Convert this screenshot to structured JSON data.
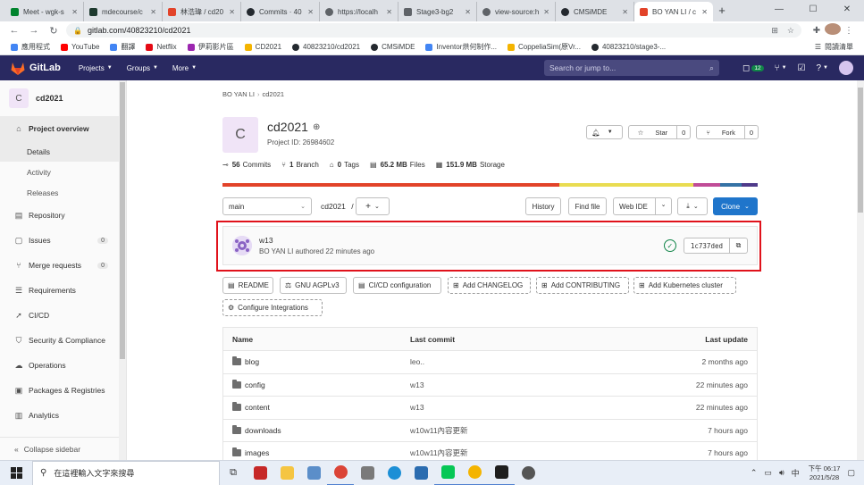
{
  "browser": {
    "tabs": [
      {
        "title": "Meet - wgk-s",
        "color": "#00832d"
      },
      {
        "title": "mdecourse/c",
        "color": "#1e3a2f"
      },
      {
        "title": "林浩瑋 / cd20",
        "color": "#e24329"
      },
      {
        "title": "Commits · 40",
        "color": "#24292f"
      },
      {
        "title": "https://localh",
        "color": "#5f6368"
      },
      {
        "title": "Stage3-bg2",
        "color": "#5f6368"
      },
      {
        "title": "view-source:h",
        "color": "#5f6368"
      },
      {
        "title": "CMSiMDE",
        "color": "#24292f"
      },
      {
        "title": "BO YAN LI / c",
        "color": "#e24329"
      }
    ],
    "new_tab": "+",
    "url": "gitlab.com/40823210/cd2021",
    "bookmarks": [
      {
        "label": "應用程式",
        "color": "#4285f4"
      },
      {
        "label": "YouTube",
        "color": "#ff0000"
      },
      {
        "label": "翻譯",
        "color": "#4285f4"
      },
      {
        "label": "Netflix",
        "color": "#e50914"
      },
      {
        "label": "伊莉影片區",
        "color": "#9c27b0"
      },
      {
        "label": "CD2021",
        "color": "#f4b400"
      },
      {
        "label": "40823210/cd2021",
        "color": "#24292f"
      },
      {
        "label": "CMSiMDE",
        "color": "#24292f"
      },
      {
        "label": "Inventor烘何制作...",
        "color": "#4285f4"
      },
      {
        "label": "CoppeliaSim(原Vr...",
        "color": "#f4b400"
      },
      {
        "label": "40823210/stage3-...",
        "color": "#24292f"
      }
    ],
    "reading_list": "閱讀清單"
  },
  "gitlab": {
    "brand": "GitLab",
    "menus": [
      "Projects",
      "Groups",
      "More"
    ],
    "search_placeholder": "Search or jump to...",
    "mr_count": "12",
    "accent": "#292961"
  },
  "sidebar": {
    "project_initial": "C",
    "project_name": "cd2021",
    "items": [
      {
        "label": "Project overview",
        "icon": "home-icon"
      },
      {
        "label": "Details"
      },
      {
        "label": "Activity"
      },
      {
        "label": "Releases"
      },
      {
        "label": "Repository",
        "icon": "doc-icon"
      },
      {
        "label": "Issues",
        "icon": "issues-icon",
        "count": "0"
      },
      {
        "label": "Merge requests",
        "icon": "merge-icon",
        "count": "0"
      },
      {
        "label": "Requirements",
        "icon": "list-icon"
      },
      {
        "label": "CI/CD",
        "icon": "rocket-icon"
      },
      {
        "label": "Security & Compliance",
        "icon": "shield-icon"
      },
      {
        "label": "Operations",
        "icon": "cloud-icon"
      },
      {
        "label": "Packages & Registries",
        "icon": "package-icon"
      },
      {
        "label": "Analytics",
        "icon": "chart-icon"
      }
    ],
    "collapse": "Collapse sidebar"
  },
  "project": {
    "breadcrumb": [
      "BO YAN LI",
      "cd2021"
    ],
    "initial": "C",
    "name": "cd2021",
    "id_text": "Project ID: 26984602",
    "star_label": "Star",
    "star_count": "0",
    "fork_label": "Fork",
    "fork_count": "0",
    "stats": {
      "commits_num": "56",
      "commits_label": "Commits",
      "branch_num": "1",
      "branch_label": "Branch",
      "tags_num": "0",
      "tags_label": "Tags",
      "files_num": "65.2 MB",
      "files_label": "Files",
      "storage_num": "151.9 MB",
      "storage_label": "Storage"
    },
    "languages": [
      {
        "pct": 63,
        "color": "#e24329"
      },
      {
        "pct": 25,
        "color": "#e9dc51"
      },
      {
        "pct": 5,
        "color": "#c04c97"
      },
      {
        "pct": 4,
        "color": "#3572a5"
      },
      {
        "pct": 3,
        "color": "#4f3a8a"
      }
    ]
  },
  "controls": {
    "branch": "main",
    "path": "cd2021",
    "path_sep": "/",
    "plus": "+",
    "history": "History",
    "find_file": "Find file",
    "web_ide": "Web IDE",
    "clone": "Clone"
  },
  "commit": {
    "title": "w13",
    "author": "BO YAN LI",
    "authored": "authored 22 minutes ago",
    "sha": "1c737ded",
    "status_color": "#108548"
  },
  "quick_links": {
    "readme": "README",
    "license": "GNU AGPLv3",
    "cicd": "CI/CD configuration",
    "changelog": "Add CHANGELOG",
    "contributing": "Add CONTRIBUTING",
    "k8s": "Add Kubernetes cluster",
    "integrations": "Configure Integrations"
  },
  "files": {
    "headers": {
      "name": "Name",
      "last_commit": "Last commit",
      "last_update": "Last update"
    },
    "rows": [
      {
        "name": "blog",
        "commit": "leo..",
        "date": "2 months ago"
      },
      {
        "name": "config",
        "commit": "w13",
        "date": "22 minutes ago"
      },
      {
        "name": "content",
        "commit": "w13",
        "date": "22 minutes ago"
      },
      {
        "name": "downloads",
        "commit": "w10w11內容更新",
        "date": "7 hours ago"
      },
      {
        "name": "images",
        "commit": "w10w11內容更新",
        "date": "7 hours ago"
      }
    ]
  },
  "taskbar": {
    "search_placeholder": "在這裡輸入文字來搜尋",
    "time": "下午 06:17",
    "date": "2021/5/28",
    "ime": "中"
  }
}
